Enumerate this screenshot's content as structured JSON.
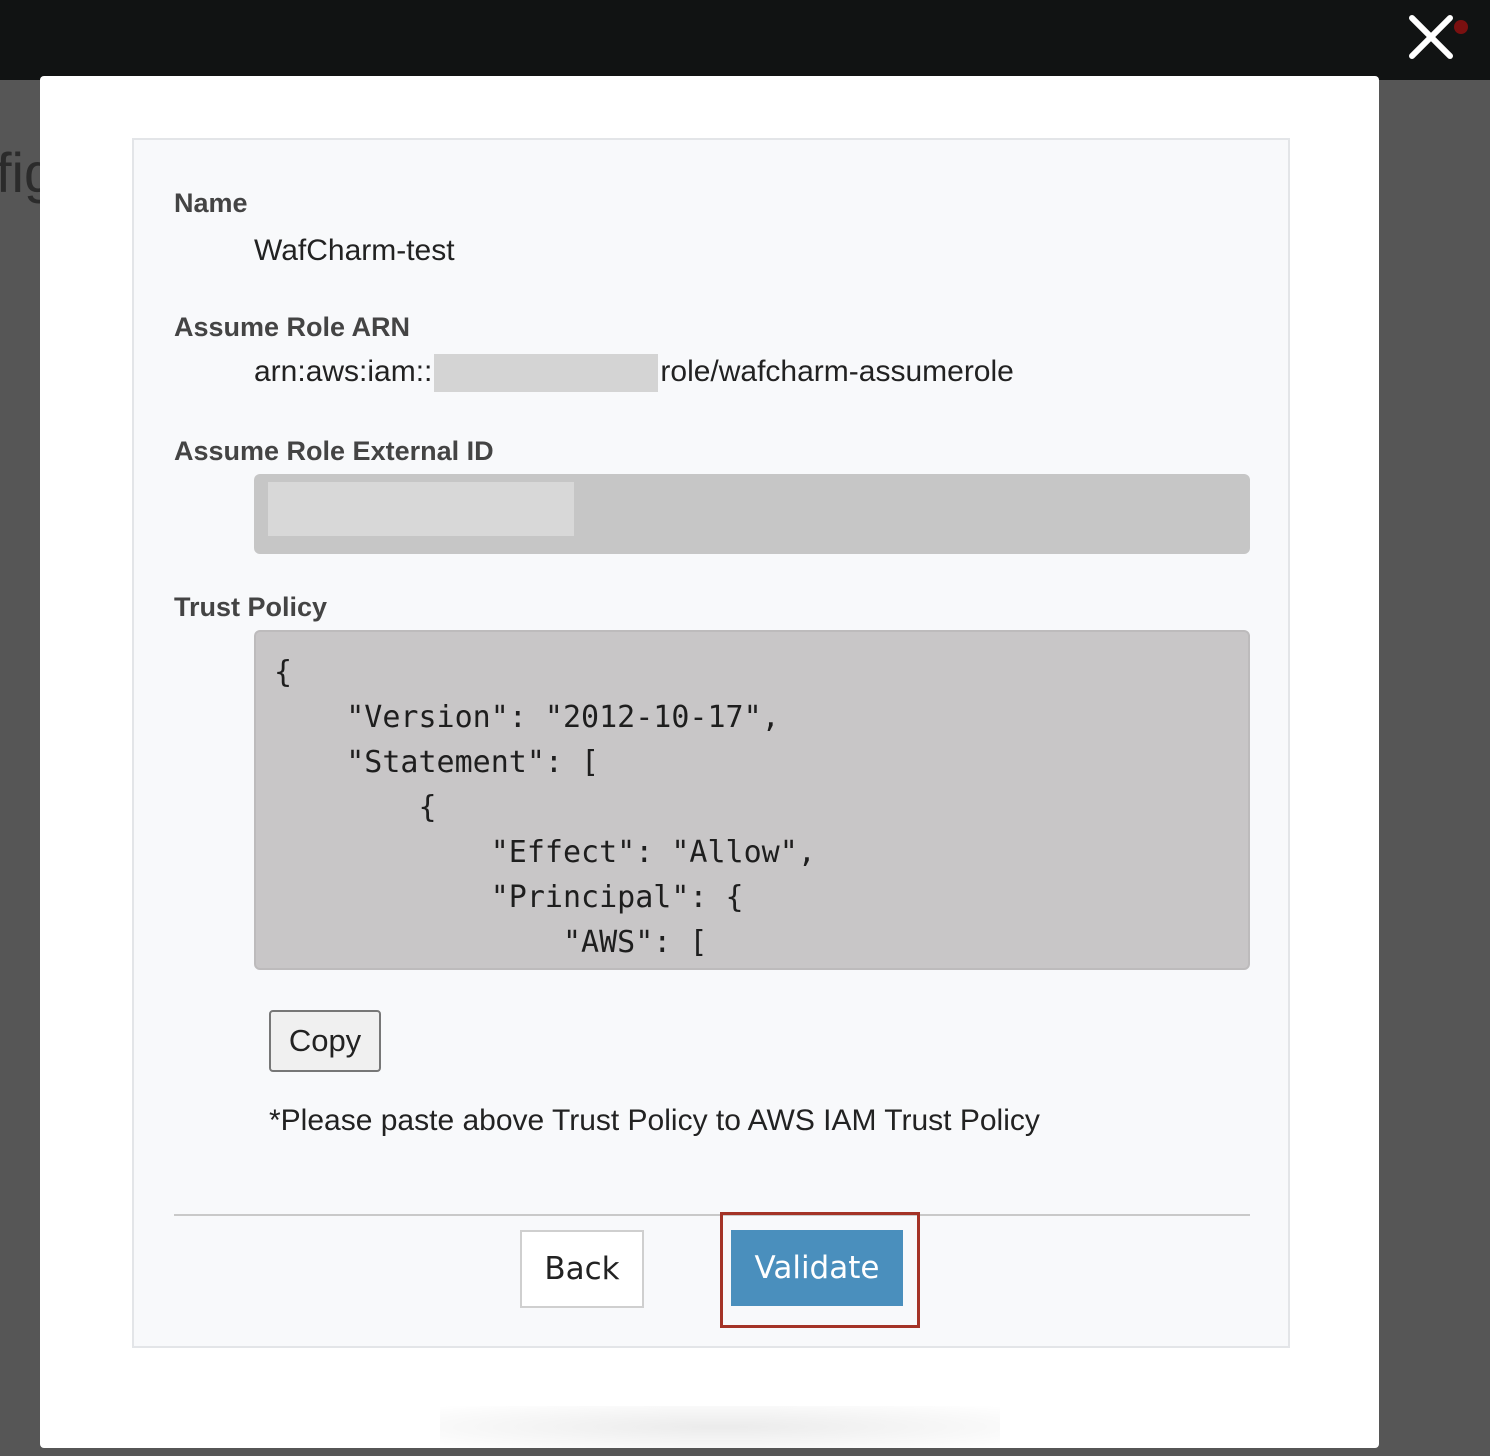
{
  "background": {
    "fragment_text": "fig"
  },
  "dialog": {
    "name_label": "Name",
    "name_value": "WafCharm-test",
    "arn_label": "Assume Role ARN",
    "arn_prefix": "arn:aws:iam::",
    "arn_suffix": "role/wafcharm-assumerole",
    "external_id_label": "Assume Role External ID",
    "trust_policy_label": "Trust Policy",
    "trust_policy_text": "{\n    \"Version\": \"2012-10-17\",\n    \"Statement\": [\n        {\n            \"Effect\": \"Allow\",\n            \"Principal\": {\n                \"AWS\": [",
    "copy_label": "Copy",
    "note": "*Please paste above Trust Policy to AWS IAM Trust Policy",
    "back_label": "Back",
    "validate_label": "Validate"
  },
  "icons": {
    "close": "close-icon"
  },
  "colors": {
    "validate_button": "#4a8fbd",
    "highlight_border": "#a43327",
    "topbar": "#111313"
  }
}
